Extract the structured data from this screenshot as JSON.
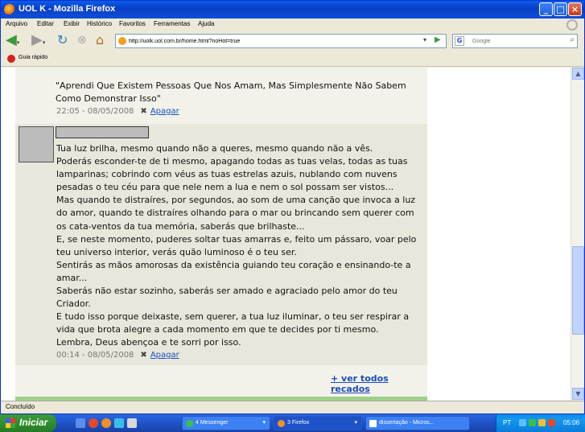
{
  "window": {
    "title": "UOL K - Mozilla Firefox"
  },
  "menu": [
    "Arquivo",
    "Editar",
    "Exibir",
    "Histórico",
    "Favoritos",
    "Ferramentas",
    "Ajuda"
  ],
  "nav": {
    "url": "http://uolk.uol.com.br/home.html?noHot=true",
    "search_placeholder": "Google"
  },
  "bookmarks": {
    "item": "Guia rápido"
  },
  "scraps": [
    {
      "text": "\"Aprendi Que Existem Pessoas Que Nos Amam, Mas Simplesmente Não Sabem Como Demonstrar Isso\"",
      "time": "22:05 - 08/05/2008",
      "delete_label": "Apagar"
    },
    {
      "lines": [
        "Tua luz brilha, mesmo quando não a queres, mesmo quando não a vês.",
        "Poderás esconder-te de ti mesmo, apagando todas as tuas velas, todas as tuas lamparinas; cobrindo com véus as tuas estrelas azuis, nublando com nuvens pesadas o teu céu para que nele nem a lua e nem o sol possam ser vistos...",
        "Mas quando te distraíres, por segundos, ao som de uma canção que invoca a luz do amor, quando te distraíres olhando para o mar ou brincando sem querer com os cata-ventos da tua memória, saberás que brilhaste...",
        "E, se neste momento, puderes soltar tuas amarras e, feito um pássaro, voar pelo teu universo interior, verás quão luminoso é o teu ser.",
        "Sentirás as mãos amorosas da existência guiando teu coração e ensinando-te a amar...",
        "Saberás não estar sozinho, saberás ser amado e agraciado pelo amor do teu Criador.",
        "E tudo isso porque deixaste, sem querer, a tua luz iluminar, o teu ser respirar a vida que brota alegre a cada momento em que te decides por ti mesmo.",
        "Lembra, Deus abençoa e te sorri por isso."
      ],
      "time": "00:14 - 08/05/2008",
      "delete_label": "Apagar"
    }
  ],
  "see_all": "+ ver todos recados",
  "status": "Concluído",
  "taskbar": {
    "start": "Iniciar",
    "tasks": [
      "4 Messenger",
      "3 Firefox",
      "dissertação - Micros..."
    ],
    "lang": "PT",
    "clock": "05:06"
  }
}
